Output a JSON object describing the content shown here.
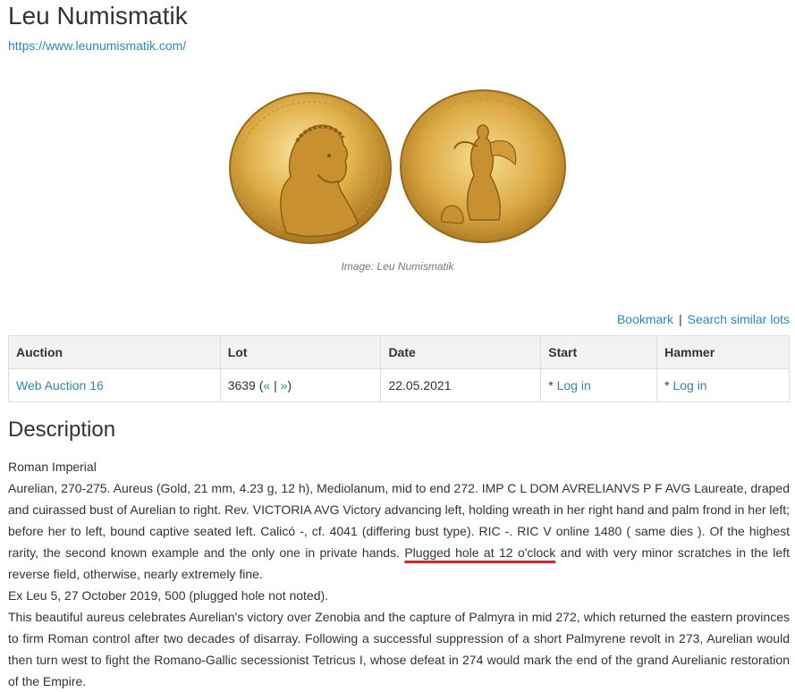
{
  "page": {
    "title": "Leu Numismatik",
    "site_url": "https://www.leunumismatik.com/",
    "image_caption": "Image: Leu Numismatik"
  },
  "coin_images": {
    "obverse": "coin-obverse-aurelian-portrait",
    "reverse": "coin-reverse-victoria",
    "obverse_legend": "IMP C L DOM AVRELIANVS P F AVG",
    "reverse_legend": "VICTORIA AVG",
    "gold_color": "#d9a93a"
  },
  "actions": {
    "bookmark": "Bookmark",
    "separator": "|",
    "search_similar": "Search similar lots"
  },
  "table": {
    "headers": {
      "auction": "Auction",
      "lot": "Lot",
      "date": "Date",
      "start": "Start",
      "hammer": "Hammer"
    },
    "row": {
      "auction": "Web Auction 16",
      "lot_number": "3639",
      "lot_prev": "«",
      "lot_sep": "|",
      "lot_next": "»",
      "date": "22.05.2021",
      "start_prefix": "* ",
      "start_login": "Log in",
      "hammer_prefix": "* ",
      "hammer_login": "Log in"
    }
  },
  "description": {
    "heading": "Description",
    "category": "Roman Imperial",
    "main_before": "Aurelian, 270-275. Aureus (Gold, 21 mm, 4.23 g, 12 h), Mediolanum, mid to end 272. IMP C L DOM AVRELIANVS P F AVG Laureate, draped and cuirassed bust of Aurelian to right. Rev. VICTORIA AVG Victory advancing left, holding wreath in her right hand and palm frond in her left; before her to left, bound captive seated left. Calicó -, cf. 4041 (differing bust type). RIC -. RIC V online 1480 ( same dies ). Of the highest rarity, the second known example and the only one in private hands. ",
    "main_highlight": "Plugged hole at 12 o'clock",
    "main_after": " and with very minor scratches in the left reverse field, otherwise, nearly extremely fine.",
    "provenance": "Ex Leu 5, 27 October 2019, 500 (plugged hole not noted).",
    "commentary": "This beautiful aureus celebrates Aurelian's victory over Zenobia and the capture of Palmyra in mid 272, which returned the eastern provinces to firm Roman control after two decades of disarray. Following a successful suppression of a short Palmyrene revolt in 273, Aurelian would then turn west to fight the Romano-Gallic secessionist Tetricus I, whose defeat in 274 would mark the end of the grand Aurelianic restoration of the Empire.",
    "highlight_color": "#e32424"
  }
}
